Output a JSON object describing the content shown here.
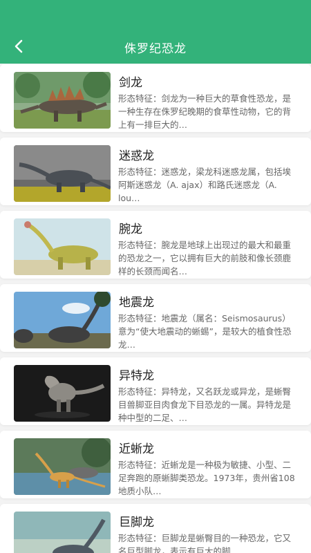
{
  "header": {
    "title": "侏罗纪恐龙"
  },
  "dinos": [
    {
      "name": "剑龙",
      "desc": "形态特征：剑龙为一种巨大的草食性恐龙，是一种生存在侏罗纪晚期的食草性动物，它的背上有一排巨大的…"
    },
    {
      "name": "迷惑龙",
      "desc": "形态特征：迷惑龙，梁龙科迷惑龙属，包括埃阿斯迷惑龙（A. ajax）和路氏迷惑龙（A. lou…"
    },
    {
      "name": "腕龙",
      "desc": "形态特征：腕龙是地球上出现过的最大和最重的恐龙之一，它以拥有巨大的前肢和像长颈鹿样的长颈而闻名…"
    },
    {
      "name": "地震龙",
      "desc": "形态特征：地震龙（属名：Seismosaurus）意为“使大地震动的蜥蜴”，是较大的植食性恐龙…"
    },
    {
      "name": "异特龙",
      "desc": "形态特征：异特龙，又名跃龙或异龙，是蜥臀目兽脚亚目肉食龙下目恐龙的一属。异特龙是种中型的二足、…"
    },
    {
      "name": "近蜥龙",
      "desc": "形态特征：近蜥龙是一种极为敏捷、小型、二足奔跑的原蜥脚类恐龙。1973年，贵州省108地质小队…"
    },
    {
      "name": "巨脚龙",
      "desc": "形态特征：巨脚龙是蜥臀目的一种恐龙，它又名巨型脚龙，表示有巨大的脚…"
    }
  ]
}
